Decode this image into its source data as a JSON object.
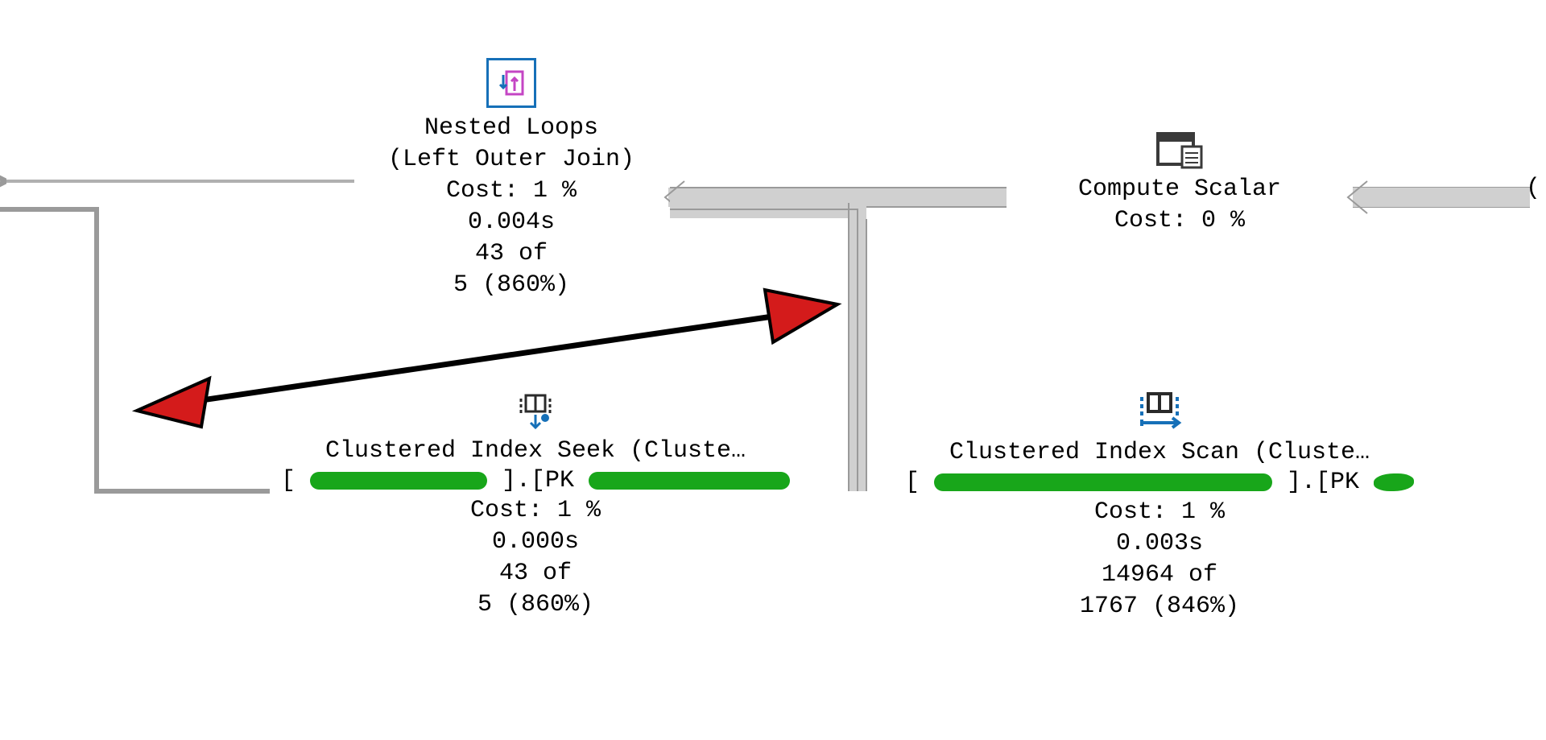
{
  "nodes": {
    "nested_loops": {
      "title": "Nested Loops",
      "subtitle": "(Left Outer Join)",
      "cost": "Cost: 1 %",
      "time": "0.004s",
      "rows_actual": "43 of",
      "rows_est": "5 (860%)"
    },
    "compute_scalar": {
      "title": "Compute Scalar",
      "cost": "Cost: 0 %"
    },
    "index_seek": {
      "title": "Clustered Index Seek (Cluste…",
      "object_prefix": "[",
      "object_mid": "].[PK",
      "cost": "Cost: 1 %",
      "time": "0.000s",
      "rows_actual": "43 of",
      "rows_est": "5 (860%)"
    },
    "index_scan": {
      "title": "Clustered Index Scan (Cluste…",
      "object_prefix": "[",
      "object_mid": "].[PK",
      "cost": "Cost: 1 %",
      "time": "0.003s",
      "rows_actual": "14964 of",
      "rows_est": "1767 (846%)"
    },
    "offscreen_right": {
      "paren": "("
    }
  },
  "icons": {
    "nested_loops": "nested-loops-icon",
    "compute_scalar": "compute-scalar-icon",
    "index_seek": "index-seek-icon",
    "index_scan": "index-scan-icon"
  },
  "annotation": {
    "arrow_color": "#d41b1b",
    "annotation_type": "double-headed-red-arrow"
  }
}
